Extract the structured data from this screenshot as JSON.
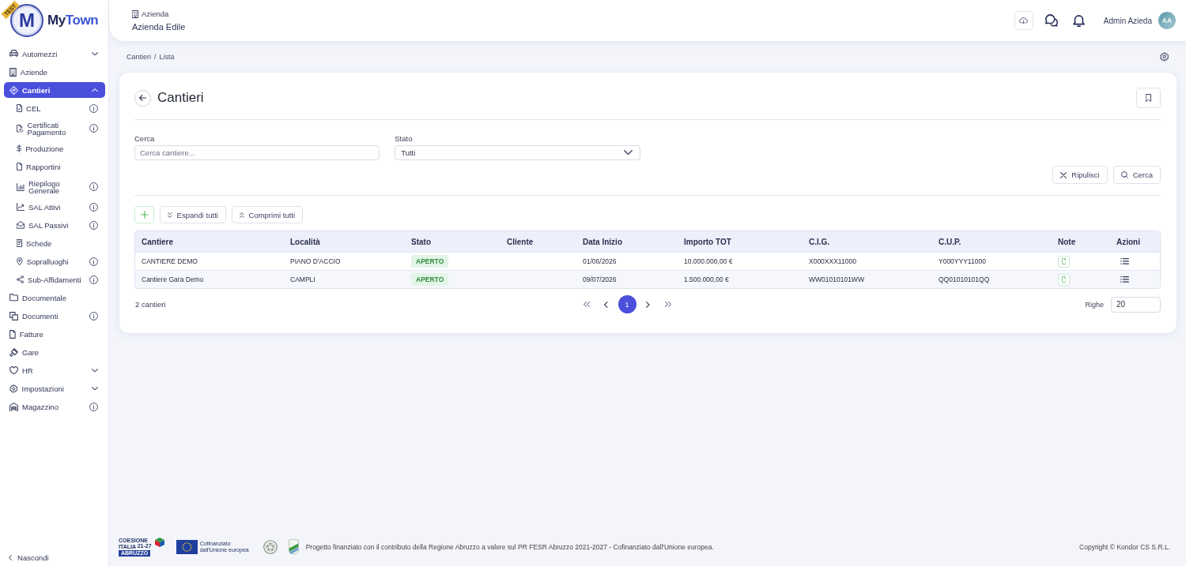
{
  "brand": {
    "badge": "TEST",
    "logo_letter": "M",
    "name_parts": [
      "My",
      "Town"
    ]
  },
  "header": {
    "company_label": "Azienda",
    "company_name": "Azienda Edile",
    "user_name": "Admin Azieda",
    "avatar_initials": "AA"
  },
  "sidebar": {
    "items": [
      {
        "label": "Automezzi",
        "kind": "group",
        "expanded": false,
        "selected": false,
        "info": false
      },
      {
        "label": "Aziende",
        "kind": "link",
        "selected": false,
        "info": false
      },
      {
        "label": "Cantieri",
        "kind": "group",
        "expanded": true,
        "selected": true,
        "info": false,
        "children": [
          {
            "label": "CEL",
            "kind": "link",
            "selected": false,
            "info": true
          },
          {
            "label": "Certificati Pagamento",
            "kind": "link",
            "selected": false,
            "info": true
          },
          {
            "label": "Produzione",
            "kind": "link",
            "selected": false,
            "info": false
          },
          {
            "label": "Rapportini",
            "kind": "link",
            "selected": false,
            "info": false
          },
          {
            "label": "Riepilogo Generale",
            "kind": "link",
            "selected": false,
            "info": true
          },
          {
            "label": "SAL Attivi",
            "kind": "link",
            "selected": false,
            "info": true
          },
          {
            "label": "SAL Passivi",
            "kind": "link",
            "selected": false,
            "info": true
          },
          {
            "label": "Schede",
            "kind": "link",
            "selected": false,
            "info": false
          },
          {
            "label": "Sopralluoghi",
            "kind": "link",
            "selected": false,
            "info": true
          },
          {
            "label": "Sub-Affidamenti",
            "kind": "link",
            "selected": false,
            "info": true
          }
        ]
      },
      {
        "label": "Documentale",
        "kind": "link",
        "selected": false,
        "info": false
      },
      {
        "label": "Documenti",
        "kind": "link",
        "selected": false,
        "info": true
      },
      {
        "label": "Fatture",
        "kind": "link",
        "selected": false,
        "info": false
      },
      {
        "label": "Gare",
        "kind": "link",
        "selected": false,
        "info": false
      },
      {
        "label": "HR",
        "kind": "group",
        "expanded": false,
        "selected": false,
        "info": false
      },
      {
        "label": "Impostazioni",
        "kind": "group",
        "expanded": false,
        "selected": false,
        "info": false
      },
      {
        "label": "Magazzino",
        "kind": "link",
        "selected": false,
        "info": true
      }
    ],
    "collapse_label": "Nascondi"
  },
  "breadcrumb": {
    "items": [
      "Cantieri",
      "Lista"
    ],
    "separator": "/"
  },
  "page": {
    "title": "Cantieri",
    "filters": [
      {
        "label": "Cerca",
        "kind": "text",
        "placeholder": "Cerca cantiere..."
      },
      {
        "label": "Stato",
        "kind": "select",
        "value": "Tutti"
      }
    ],
    "filter_actions": [
      {
        "label": "Ripulisci",
        "kind": "clear"
      },
      {
        "label": "Cerca",
        "kind": "search"
      }
    ],
    "toolbar": [
      {
        "kind": "add"
      },
      {
        "kind": "expand",
        "label": "Espandi tutti"
      },
      {
        "kind": "collapse",
        "label": "Comprimi tutti"
      }
    ],
    "table": {
      "columns": [
        {
          "label": "Cantiere",
          "kind": "text"
        },
        {
          "label": "Località",
          "kind": "text"
        },
        {
          "label": "Stato",
          "kind": "badge"
        },
        {
          "label": "Cliente",
          "kind": "text"
        },
        {
          "label": "Data Inizio",
          "kind": "text"
        },
        {
          "label": "Importo TOT",
          "kind": "text"
        },
        {
          "label": "C.I.G.",
          "kind": "text"
        },
        {
          "label": "C.U.P.",
          "kind": "text"
        },
        {
          "label": "Note",
          "kind": "note"
        },
        {
          "label": "Azioni",
          "kind": "actions"
        }
      ],
      "rows": [
        {
          "cells": [
            "CANTIERE DEMO",
            "PIANO D'ACCIO",
            "APERTO",
            null,
            "01/06/2026",
            "10.000.000,00 €",
            "X000XXX11000",
            "Y000YYY11000"
          ]
        },
        {
          "cells": [
            "Cantiere Gara Demo",
            "CAMPLI",
            "APERTO",
            null,
            "09/07/2026",
            "1.500.000,00 €",
            "WW01010101WW",
            "QQ01010101QQ"
          ]
        }
      ]
    },
    "result_count": "2 cantieri",
    "pagination": {
      "pages": [
        {
          "label": "1",
          "selected": true
        }
      ]
    },
    "rows_per_page": {
      "label": "Righe",
      "value": "20"
    }
  },
  "footer": {
    "logos": [
      {
        "kind": "coesione",
        "lines": [
          "COESIONE",
          "ITALIA $^{21-27}$"
        ],
        "banner": "ABRUZZO"
      },
      {
        "kind": "eu",
        "caption": "Cofinanziato dall'Unione europea"
      },
      {
        "kind": "emblem"
      },
      {
        "kind": "region"
      }
    ],
    "text": "Progetto finanziato con il contributo della Regione Abruzzo a valere sul PR FESR Abruzzo 2021-2027 - Cofinanziato dall'Unione europea.",
    "copyright": "Copyright © Kondor CS S.R.L."
  }
}
